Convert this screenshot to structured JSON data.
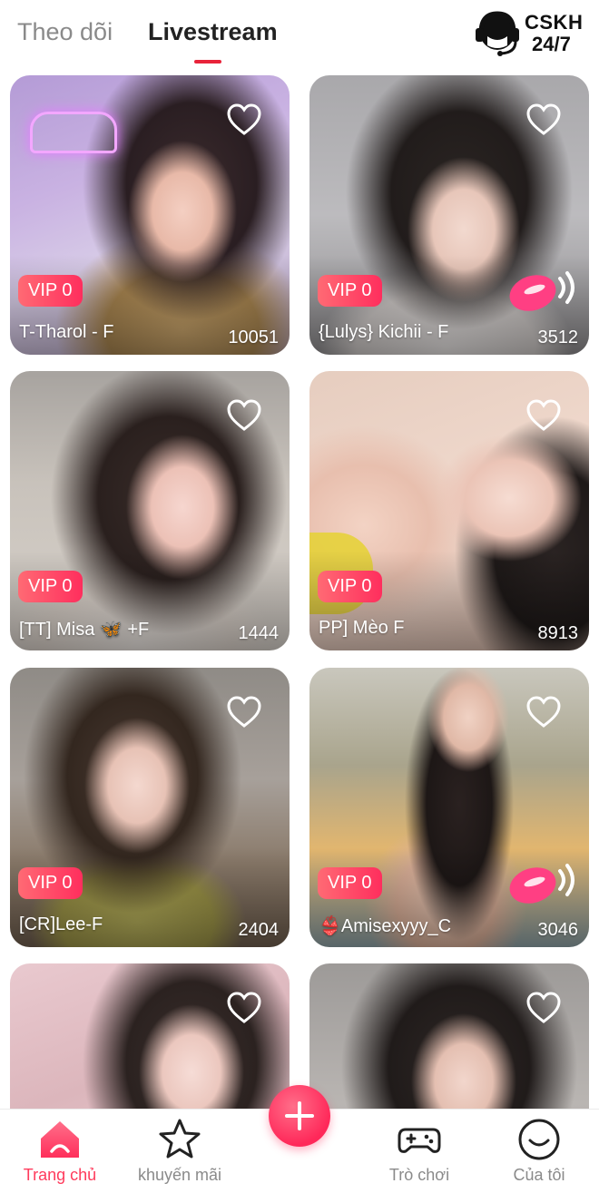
{
  "header": {
    "tabs": [
      {
        "label": "Theo dõi",
        "active": false
      },
      {
        "label": "Livestream",
        "active": true
      }
    ],
    "support": {
      "line1": "CSKH",
      "line2": "24/7",
      "icon": "headset-agent-icon"
    }
  },
  "streams": [
    {
      "badge": "VIP 0",
      "name": "T-Tharol - F",
      "viewers": "10051",
      "live_icon": false
    },
    {
      "badge": "VIP 0",
      "name": "{Lulys} Kichii - F",
      "viewers": "3512",
      "live_icon": true
    },
    {
      "badge": "VIP 0",
      "name": "[TT] Misa 🦋 +F",
      "viewers": "1444",
      "live_icon": false
    },
    {
      "badge": "VIP 0",
      "name": "PP] Mèo F",
      "viewers": "8913",
      "live_icon": false
    },
    {
      "badge": "VIP 0",
      "name": "[CR]Lee-F",
      "viewers": "2404",
      "live_icon": false
    },
    {
      "badge": "VIP 0",
      "name": "👙Amisexyyy_C",
      "viewers": "3046",
      "live_icon": true
    },
    {
      "badge": "",
      "name": "",
      "viewers": "",
      "live_icon": false
    },
    {
      "badge": "",
      "name": "",
      "viewers": "",
      "live_icon": false
    }
  ],
  "bottom_nav": [
    {
      "label": "Trang chủ",
      "icon": "home-icon",
      "active": true
    },
    {
      "label": "khuyến mãi",
      "icon": "star-icon",
      "active": false
    },
    {
      "label": "",
      "icon": "plus-icon",
      "active": false
    },
    {
      "label": "Trò chơi",
      "icon": "gamepad-icon",
      "active": false
    },
    {
      "label": "Của tôi",
      "icon": "smile-profile-icon",
      "active": false
    }
  ],
  "colors": {
    "accent": "#ff3b5c",
    "vip_badge": "#ff4a66",
    "indicator": "#e8233a"
  }
}
